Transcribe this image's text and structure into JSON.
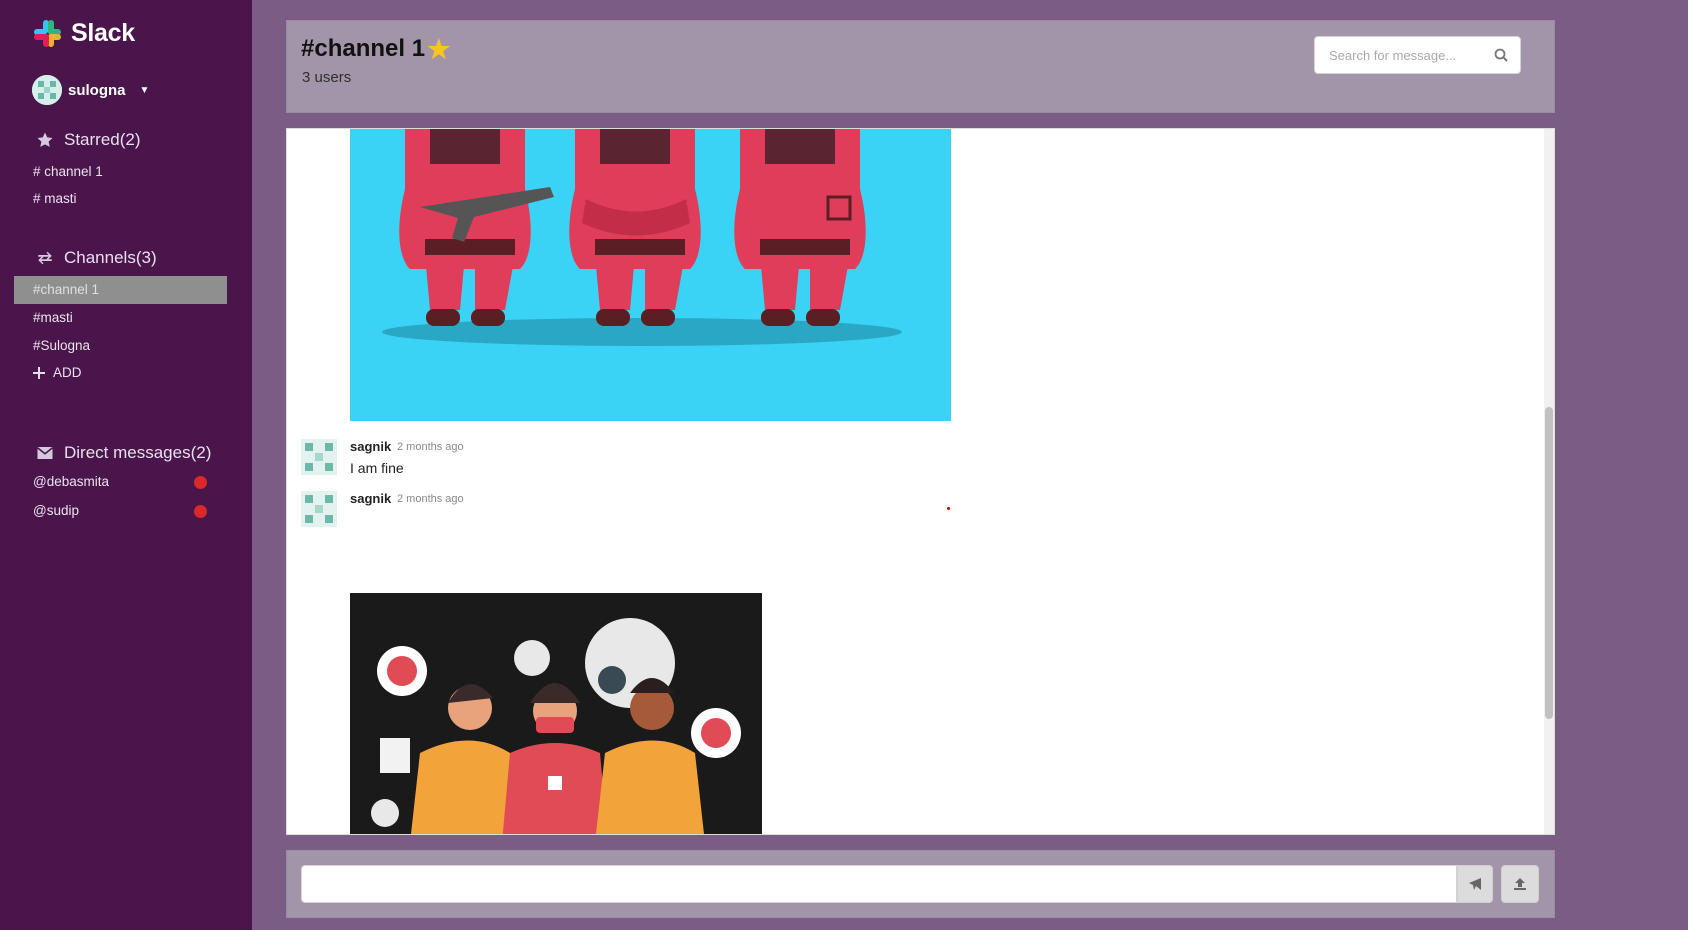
{
  "app": {
    "name": "Slack"
  },
  "user": {
    "name": "sulogna"
  },
  "sidebar": {
    "starred": {
      "title": "Starred(2)",
      "items": [
        "# channel 1",
        "# masti"
      ]
    },
    "channels": {
      "title": "Channels(3)",
      "items": [
        "#channel 1",
        "#masti",
        "#Sulogna"
      ],
      "active": "#channel 1",
      "add_label": "ADD"
    },
    "direct": {
      "title": "Direct messages(2)",
      "items": [
        "@debasmita",
        "@sudip"
      ]
    }
  },
  "header": {
    "title": "#channel 1",
    "users": "3 users",
    "search_placeholder": "Search for message..."
  },
  "messages": [
    {
      "author": "sagnik",
      "time": "2 months ago",
      "text": "I am fine"
    },
    {
      "author": "sagnik",
      "time": "2 months ago",
      "text": ""
    }
  ],
  "composer": {
    "value": ""
  },
  "colors": {
    "sidebar": "#4a154b",
    "background": "#7a5c85",
    "header": "#a395a9",
    "active_item": "#8f8f8f",
    "badge": "#db2828"
  }
}
